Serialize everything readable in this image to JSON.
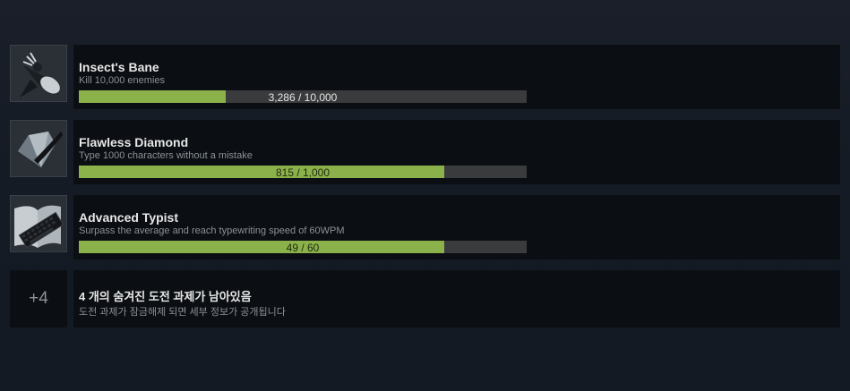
{
  "achievements": [
    {
      "title": "Insect's Bane",
      "description": "Kill 10,000 enemies",
      "progress_text": "3,286 / 10,000",
      "progress": 0.3286,
      "icon": "insect-spray-icon"
    },
    {
      "title": "Flawless Diamond",
      "description": "Type 1000 characters without a mistake",
      "progress_text": "815 / 1,000",
      "progress": 0.815,
      "icon": "diamond-icon"
    },
    {
      "title": "Advanced Typist",
      "description": "Surpass the average and reach typewriting speed of 60WPM",
      "progress_text": "49 / 60",
      "progress": 0.8167,
      "icon": "keyboard-icon"
    }
  ],
  "hidden": {
    "count_label": "+4",
    "title": "4 개의 숨겨진 도전 과제가 남아있음",
    "description": "도전 과제가 잠금해제 되면 세부 정보가 공개됩니다"
  },
  "colors": {
    "progress_fill": "#8bb24a",
    "progress_track": "#3a3b3d",
    "panel_bg": "#0b0e12"
  }
}
